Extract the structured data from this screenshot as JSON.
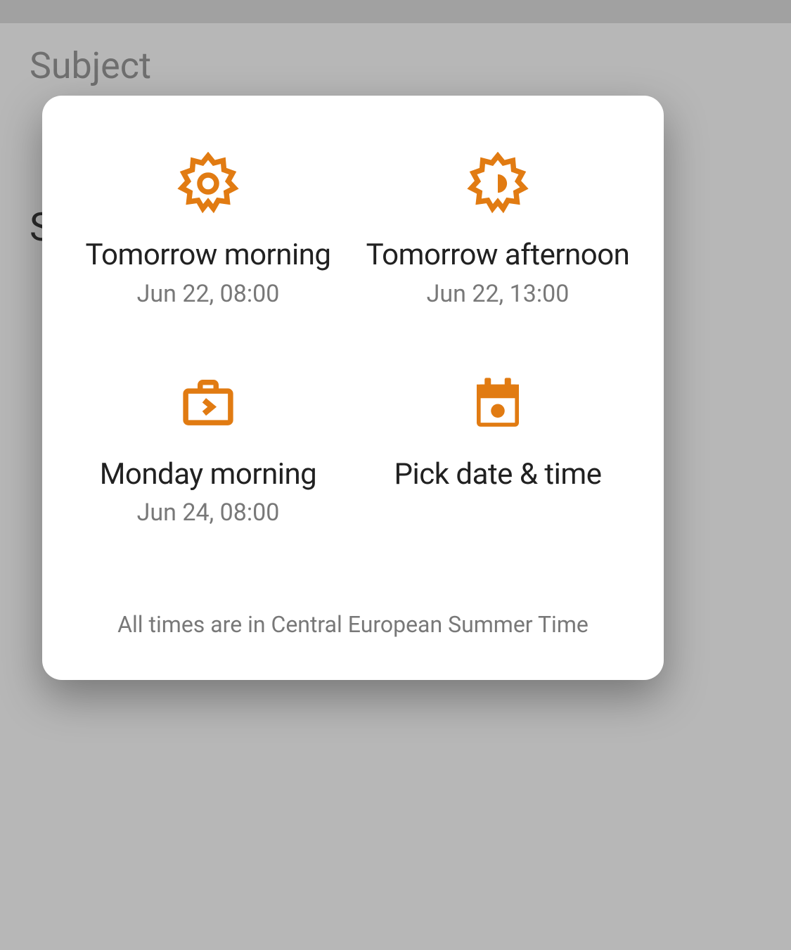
{
  "background": {
    "subject_placeholder": "Subject",
    "partial_text": "S"
  },
  "dialog": {
    "options": [
      {
        "title": "Tomorrow morning",
        "subtitle": "Jun 22, 08:00",
        "icon": "sun-full-icon"
      },
      {
        "title": "Tomorrow afternoon",
        "subtitle": "Jun 22, 13:00",
        "icon": "sun-half-icon"
      },
      {
        "title": "Monday morning",
        "subtitle": "Jun 24, 08:00",
        "icon": "briefcase-next-icon"
      },
      {
        "title": "Pick date & time",
        "subtitle": "",
        "icon": "calendar-icon"
      }
    ],
    "footer": "All times are in Central European Summer Time"
  },
  "colors": {
    "accent": "#e17b12"
  }
}
